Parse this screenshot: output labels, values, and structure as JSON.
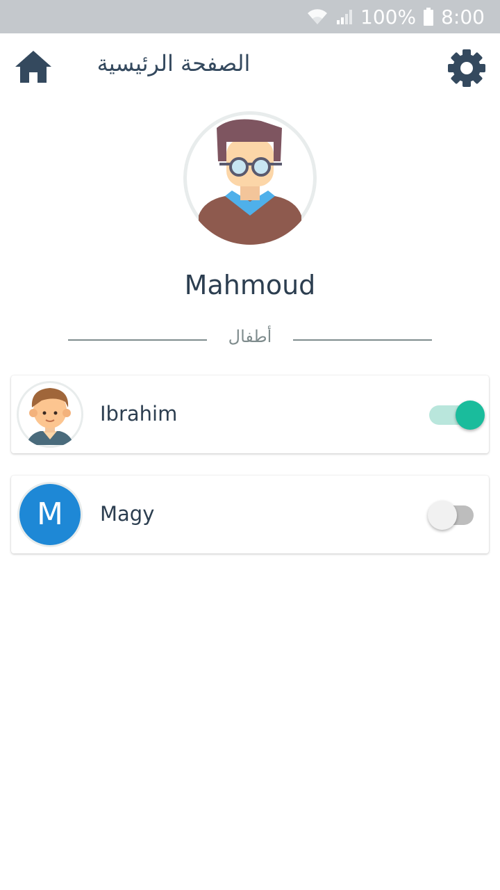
{
  "status_bar": {
    "battery_text": "100%",
    "time": "8:00",
    "icons": [
      "wifi-icon",
      "signal-icon",
      "battery-icon"
    ]
  },
  "app_bar": {
    "title": "الصفحة الرئيسية",
    "home_icon": "home-icon",
    "settings_icon": "gear-icon"
  },
  "profile": {
    "name": "Mahmoud",
    "avatar": "man-with-glasses-avatar"
  },
  "children_section": {
    "label": "أطفال"
  },
  "children": [
    {
      "name": "Ibrahim",
      "avatar": "boy-avatar",
      "enabled": true
    },
    {
      "name": "Magy",
      "avatar_letter": "M",
      "enabled": false
    }
  ],
  "colors": {
    "primary_text": "#2c3e50",
    "icon": "#34495e",
    "toggle_on": "#1abc9c",
    "letter_avatar_bg": "#1e88d6",
    "status_bar": "#c4c8cc"
  }
}
